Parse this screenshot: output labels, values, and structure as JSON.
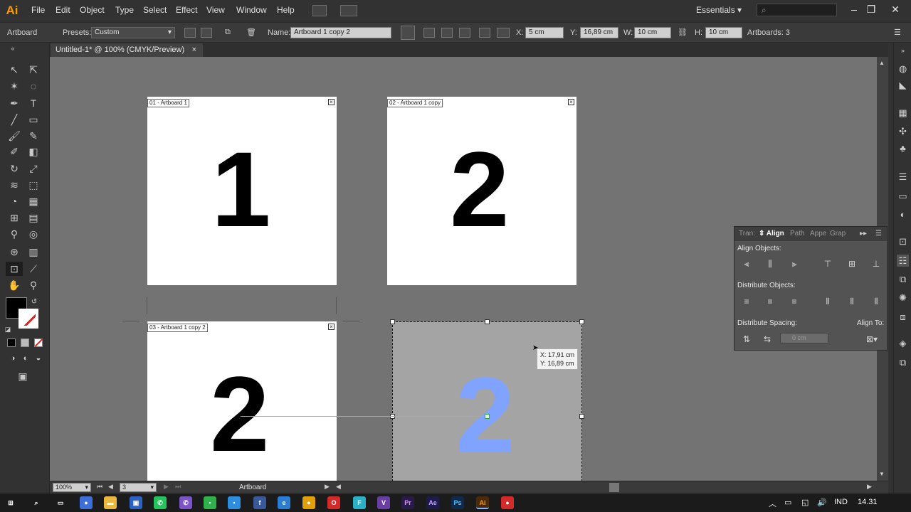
{
  "app": {
    "logo": "Ai",
    "accent": "#ff9a00"
  },
  "menu": [
    "File",
    "Edit",
    "Object",
    "Type",
    "Select",
    "Effect",
    "View",
    "Window",
    "Help"
  ],
  "workspace": {
    "label": "Essentials"
  },
  "control_bar": {
    "tool_name": "Artboard",
    "presets_label": "Presets:",
    "presets_value": "Custom",
    "name_label": "Name:",
    "name_value": "Artboard 1 copy 2",
    "x_label": "X:",
    "x_value": "5 cm",
    "y_label": "Y:",
    "y_value": "16,89 cm",
    "w_label": "W:",
    "w_value": "10 cm",
    "h_label": "H:",
    "h_value": "10 cm",
    "artboards_label": "Artboards: 3"
  },
  "document_tab": {
    "title": "Untitled-1* @ 100% (CMYK/Preview)",
    "close": "×"
  },
  "canvas": {
    "artboards": [
      {
        "label": "01 - Artboard 1",
        "digit": "1"
      },
      {
        "label": "02 - Artboard 1 copy",
        "digit": "2"
      },
      {
        "label": "03 - Artboard 1 copy 2",
        "digit": "2"
      }
    ],
    "selection_digit": "2",
    "selection_digit_color": "#7fa3ff",
    "coord_tooltip": {
      "x": "X: 17,91 cm",
      "y": "Y: 16,89 cm"
    }
  },
  "status_bar": {
    "zoom": "100%",
    "artboard_number": "3",
    "tool_label": "Artboard"
  },
  "align_panel": {
    "tabs": [
      "Tran:",
      "Align",
      "Path",
      "Appe",
      "Grap"
    ],
    "align_objects_label": "Align Objects:",
    "distribute_objects_label": "Distribute Objects:",
    "distribute_spacing_label": "Distribute Spacing:",
    "align_to_label": "Align To:",
    "spacing_value": "0 cm"
  },
  "taskbar": {
    "lang": "IND",
    "time": "14.31",
    "apps": [
      {
        "name": "windows-start-icon",
        "glyph": "⊞",
        "color": "#1b1b1b"
      },
      {
        "name": "search-icon",
        "glyph": "⌕",
        "color": "#1b1b1b"
      },
      {
        "name": "task-view-icon",
        "glyph": "▭",
        "color": "#1b1b1b"
      },
      {
        "name": "chrome-app-icon",
        "glyph": "●",
        "color": "#3e6fd8"
      },
      {
        "name": "folder-app-icon",
        "glyph": "▬",
        "color": "#e8b93e"
      },
      {
        "name": "store-app-icon",
        "glyph": "▣",
        "color": "#2a63c5"
      },
      {
        "name": "whatsapp-app-icon",
        "glyph": "✆",
        "color": "#25c25e"
      },
      {
        "name": "viber-app-icon",
        "glyph": "✆",
        "color": "#7b55c7"
      },
      {
        "name": "chat-app-icon",
        "glyph": "▪",
        "color": "#2fb24c"
      },
      {
        "name": "app-icon",
        "glyph": "▪",
        "color": "#2d8ee0"
      },
      {
        "name": "facebook-app-icon",
        "glyph": "f",
        "color": "#3b5998"
      },
      {
        "name": "edge-app-icon",
        "glyph": "e",
        "color": "#2b7cd3"
      },
      {
        "name": "chrome-browser-icon",
        "glyph": "●",
        "color": "#e0a10a"
      },
      {
        "name": "opera-app-icon",
        "glyph": "O",
        "color": "#d42a2a"
      },
      {
        "name": "app-f-icon",
        "glyph": "F",
        "color": "#2ab0c7"
      },
      {
        "name": "app-v-icon",
        "glyph": "V",
        "color": "#6a3fa3"
      },
      {
        "name": "premiere-app-icon",
        "glyph": "Pr",
        "color": "#2a1a4a"
      },
      {
        "name": "after-effects-app-icon",
        "glyph": "Ae",
        "color": "#1e1a4a"
      },
      {
        "name": "photoshop-app-icon",
        "glyph": "Ps",
        "color": "#0f2a4a"
      },
      {
        "name": "illustrator-app-icon",
        "glyph": "Ai",
        "color": "#4a2a0a"
      },
      {
        "name": "record-app-icon",
        "glyph": "●",
        "color": "#d42a2a"
      }
    ]
  }
}
